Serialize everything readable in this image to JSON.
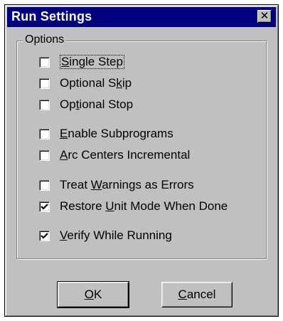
{
  "window": {
    "title": "Run Settings",
    "close_glyph": "✕"
  },
  "options_group": {
    "label": "Options"
  },
  "checkboxes": [
    {
      "label": "Single Step",
      "checked": false,
      "hotkey": "S"
    },
    {
      "label": "Optional Skip",
      "checked": false,
      "hotkey": "k"
    },
    {
      "label": "Optional Stop",
      "checked": false,
      "hotkey": "t"
    },
    {
      "label": "Enable Subprograms",
      "checked": false,
      "hotkey": "E"
    },
    {
      "label": "Arc Centers Incremental",
      "checked": false,
      "hotkey": "A"
    },
    {
      "label": "Treat Warnings as Errors",
      "checked": false,
      "hotkey": "W"
    },
    {
      "label": "Restore Unit Mode When Done",
      "checked": true,
      "hotkey": "U"
    },
    {
      "label": "Verify While Running",
      "checked": true,
      "hotkey": "V"
    }
  ],
  "buttons": {
    "ok_label": "OK",
    "cancel_label": "Cancel"
  }
}
